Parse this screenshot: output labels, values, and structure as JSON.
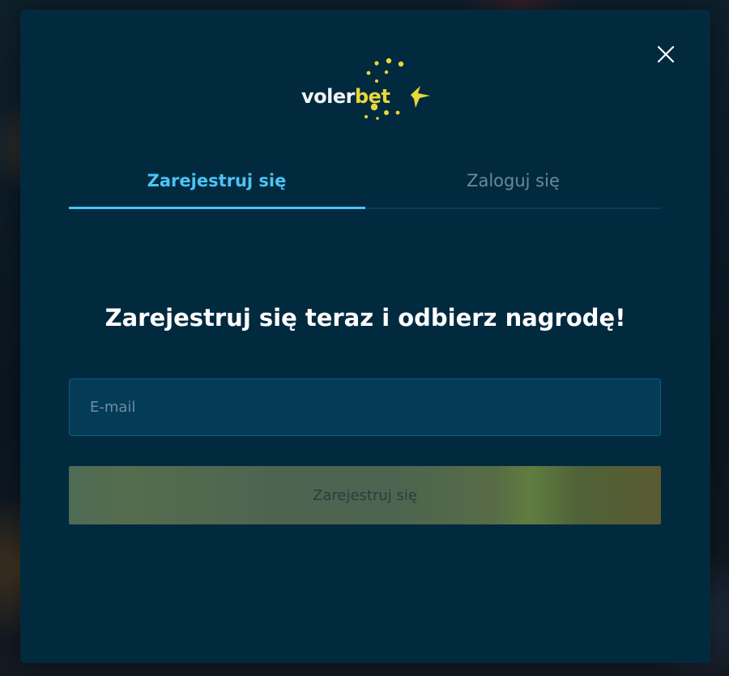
{
  "brand": {
    "name_part1": "voler",
    "name_part2": "bet",
    "primary_color": "#022a3f",
    "accent_color": "#4cc3f5",
    "logo_color": "#e8d63a"
  },
  "modal": {
    "close_icon": "close-icon"
  },
  "tabs": [
    {
      "label": "Zarejestruj się",
      "active": true
    },
    {
      "label": "Zaloguj się",
      "active": false
    }
  ],
  "form": {
    "headline": "Zarejestruj się teraz i odbierz nagrodę!",
    "email_placeholder": "E-mail",
    "email_value": "",
    "submit_label": "Zarejestruj się"
  }
}
